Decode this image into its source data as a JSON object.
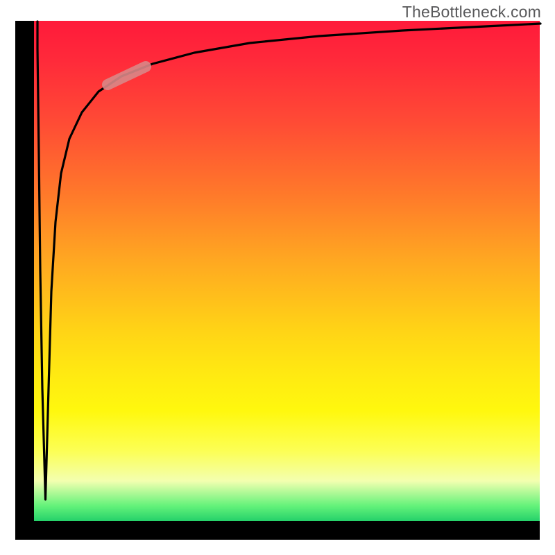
{
  "watermark": "TheBottleneck.com",
  "colors": {
    "gradient_top": "#ff1a3a",
    "gradient_mid_orange": "#ffa821",
    "gradient_yellow": "#fff80e",
    "gradient_bottom_green": "#25d16a",
    "frame": "#000000",
    "curve": "#000000",
    "highlight": "#d98787",
    "watermark_text": "#59595b"
  },
  "chart_data": {
    "type": "line",
    "title": "",
    "xlabel": "",
    "ylabel": "",
    "xlim": [
      0,
      100
    ],
    "ylim": [
      0,
      100
    ],
    "grid": false,
    "legend": false,
    "note": "Values are estimated from pixel positions; axes unlabeled in source image. y = 100 at top, 0 at bottom.",
    "series": [
      {
        "name": "curve",
        "x": [
          0.7,
          0.7,
          1.0,
          1.3,
          1.6,
          2.3,
          2.9,
          3.4,
          4.3,
          5.4,
          7.0,
          9.5,
          12.8,
          17.3,
          23.5,
          31.7,
          42.6,
          56.4,
          72.8,
          89.3,
          100.0
        ],
        "y": [
          100.0,
          94.6,
          73.8,
          50.2,
          26.6,
          4.3,
          26.6,
          45.9,
          59.8,
          69.5,
          76.4,
          81.7,
          85.9,
          89.0,
          91.4,
          93.6,
          95.6,
          96.9,
          98.1,
          98.9,
          99.4
        ]
      },
      {
        "name": "highlight-segment",
        "x": [
          14.5,
          22.1
        ],
        "y": [
          87.4,
          91.0
        ]
      }
    ],
    "background_gradient": {
      "direction": "vertical",
      "stops": [
        {
          "pos": 0.0,
          "color": "#ff1a3a"
        },
        {
          "pos": 0.35,
          "color": "#ff7a2a"
        },
        {
          "pos": 0.62,
          "color": "#ffd416"
        },
        {
          "pos": 0.78,
          "color": "#fff80e"
        },
        {
          "pos": 0.97,
          "color": "#63f27a"
        },
        {
          "pos": 1.0,
          "color": "#25d16a"
        }
      ]
    }
  }
}
